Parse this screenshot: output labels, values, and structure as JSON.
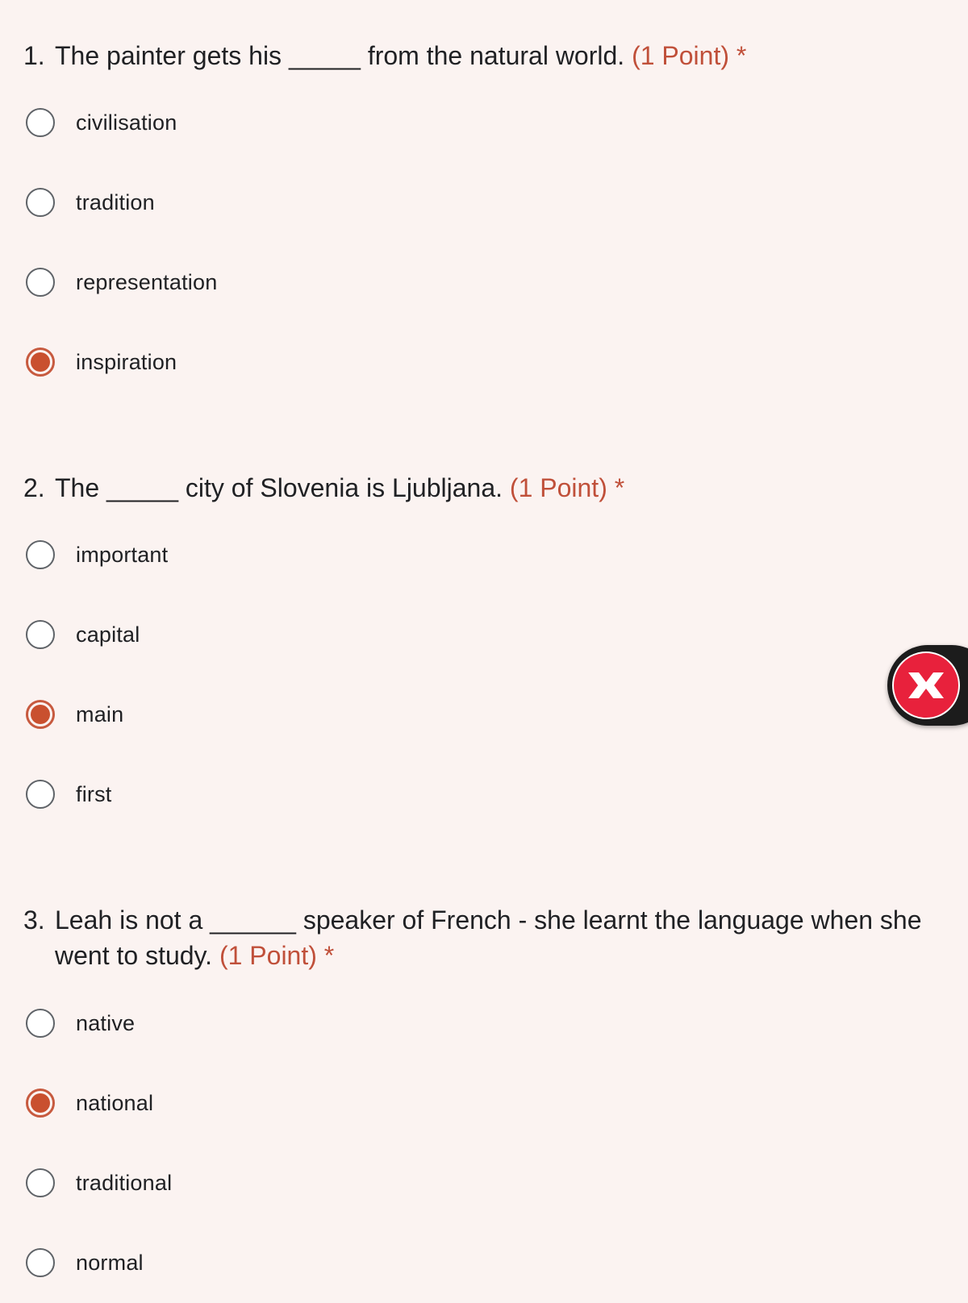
{
  "questions": [
    {
      "number": "1.",
      "text_before": "The painter gets his",
      "blank": "_____",
      "text_after": "from the natural world.",
      "continuation": "",
      "points": "(1 Point)",
      "required": "*",
      "options": [
        {
          "label": "civilisation",
          "selected": false
        },
        {
          "label": "tradition",
          "selected": false
        },
        {
          "label": "representation",
          "selected": false
        },
        {
          "label": "inspiration",
          "selected": true
        }
      ]
    },
    {
      "number": "2.",
      "text_before": "The",
      "blank": "_____",
      "text_after": "city of Slovenia is Ljubljana.",
      "continuation": "",
      "points": "(1 Point)",
      "required": "*",
      "options": [
        {
          "label": "important",
          "selected": false
        },
        {
          "label": "capital",
          "selected": false
        },
        {
          "label": "main",
          "selected": true
        },
        {
          "label": "first",
          "selected": false
        }
      ]
    },
    {
      "number": "3.",
      "text_before": "Leah is not a",
      "blank": "______",
      "text_after": "speaker of French - she learnt the language when she",
      "continuation": "went to study.",
      "points": "(1 Point)",
      "required": "*",
      "options": [
        {
          "label": "native",
          "selected": false
        },
        {
          "label": "national",
          "selected": true
        },
        {
          "label": "traditional",
          "selected": false
        },
        {
          "label": "normal",
          "selected": false
        }
      ]
    }
  ],
  "floating_button": {
    "icon": "x-logo-icon"
  },
  "colors": {
    "accent": "#c9502f",
    "points_text": "#c0503a",
    "background": "#fbf3f1"
  }
}
